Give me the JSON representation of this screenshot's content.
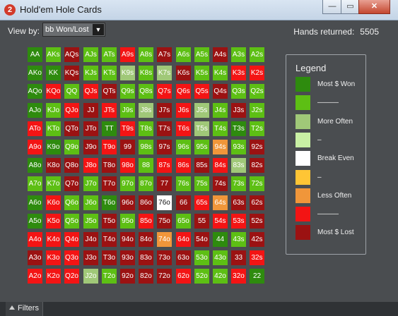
{
  "window": {
    "title": "Hold'em Hole Cards",
    "app_icon_text": "2",
    "minimize_glyph": "—",
    "maximize_glyph": "▭",
    "close_glyph": "✕"
  },
  "toolbar": {
    "view_by_label": "View by:",
    "view_by_value": "bb Won/Lost",
    "dropdown_arrow": "▼",
    "hands_label": "Hands returned:",
    "hands_value": "5505"
  },
  "colors": {
    "dg": "#2e8b0e",
    "mg": "#5dbf14",
    "lg": "#a0c878",
    "pg": "#c9f0a4",
    "wh": "#ffffff",
    "yl": "#ffc535",
    "or": "#f0963a",
    "rd": "#f31414",
    "dr": "#9b1212"
  },
  "grid": {
    "rows": [
      [
        {
          "t": "AA",
          "c": "dg"
        },
        {
          "t": "AKs",
          "c": "mg"
        },
        {
          "t": "AQs",
          "c": "dr"
        },
        {
          "t": "AJs",
          "c": "mg"
        },
        {
          "t": "ATs",
          "c": "mg"
        },
        {
          "t": "A9s",
          "c": "rd"
        },
        {
          "t": "A8s",
          "c": "mg"
        },
        {
          "t": "A7s",
          "c": "dr"
        },
        {
          "t": "A6s",
          "c": "mg"
        },
        {
          "t": "A5s",
          "c": "mg"
        },
        {
          "t": "A4s",
          "c": "dr"
        },
        {
          "t": "A3s",
          "c": "mg"
        },
        {
          "t": "A2s",
          "c": "mg"
        }
      ],
      [
        {
          "t": "AKo",
          "c": "dg"
        },
        {
          "t": "KK",
          "c": "dg"
        },
        {
          "t": "KQs",
          "c": "dr"
        },
        {
          "t": "KJs",
          "c": "mg"
        },
        {
          "t": "KTs",
          "c": "mg"
        },
        {
          "t": "K9s",
          "c": "lg"
        },
        {
          "t": "K8s",
          "c": "mg"
        },
        {
          "t": "K7s",
          "c": "lg"
        },
        {
          "t": "K6s",
          "c": "dr"
        },
        {
          "t": "K5s",
          "c": "mg"
        },
        {
          "t": "K4s",
          "c": "mg"
        },
        {
          "t": "K3s",
          "c": "rd"
        },
        {
          "t": "K2s",
          "c": "rd"
        }
      ],
      [
        {
          "t": "AQo",
          "c": "dg"
        },
        {
          "t": "KQo",
          "c": "rd"
        },
        {
          "t": "QQ",
          "c": "mg"
        },
        {
          "t": "QJs",
          "c": "rd"
        },
        {
          "t": "QTs",
          "c": "dr"
        },
        {
          "t": "Q9s",
          "c": "mg"
        },
        {
          "t": "Q8s",
          "c": "mg"
        },
        {
          "t": "Q7s",
          "c": "rd"
        },
        {
          "t": "Q6s",
          "c": "rd"
        },
        {
          "t": "Q5s",
          "c": "rd"
        },
        {
          "t": "Q4s",
          "c": "dr"
        },
        {
          "t": "Q3s",
          "c": "mg"
        },
        {
          "t": "Q2s",
          "c": "mg"
        }
      ],
      [
        {
          "t": "AJo",
          "c": "dg"
        },
        {
          "t": "KJo",
          "c": "mg"
        },
        {
          "t": "QJo",
          "c": "rd"
        },
        {
          "t": "JJ",
          "c": "dr"
        },
        {
          "t": "JTs",
          "c": "rd"
        },
        {
          "t": "J9s",
          "c": "mg"
        },
        {
          "t": "J8s",
          "c": "lg"
        },
        {
          "t": "J7s",
          "c": "dr"
        },
        {
          "t": "J6s",
          "c": "rd"
        },
        {
          "t": "J5s",
          "c": "lg"
        },
        {
          "t": "J4s",
          "c": "mg"
        },
        {
          "t": "J3s",
          "c": "dr"
        },
        {
          "t": "J2s",
          "c": "mg"
        }
      ],
      [
        {
          "t": "ATo",
          "c": "rd"
        },
        {
          "t": "KTo",
          "c": "mg"
        },
        {
          "t": "QTo",
          "c": "dr"
        },
        {
          "t": "JTo",
          "c": "dr"
        },
        {
          "t": "TT",
          "c": "dg"
        },
        {
          "t": "T9s",
          "c": "rd"
        },
        {
          "t": "T8s",
          "c": "mg"
        },
        {
          "t": "T7s",
          "c": "dr"
        },
        {
          "t": "T6s",
          "c": "rd"
        },
        {
          "t": "T5s",
          "c": "lg"
        },
        {
          "t": "T4s",
          "c": "mg"
        },
        {
          "t": "T3s",
          "c": "dg"
        },
        {
          "t": "T2s",
          "c": "mg"
        }
      ],
      [
        {
          "t": "A9o",
          "c": "rd"
        },
        {
          "t": "K9o",
          "c": "dg"
        },
        {
          "t": "Q9o",
          "c": "mg"
        },
        {
          "t": "J9o",
          "c": "dr"
        },
        {
          "t": "T9o",
          "c": "rd"
        },
        {
          "t": "99",
          "c": "dr"
        },
        {
          "t": "98s",
          "c": "mg"
        },
        {
          "t": "97s",
          "c": "dr"
        },
        {
          "t": "96s",
          "c": "mg"
        },
        {
          "t": "95s",
          "c": "mg"
        },
        {
          "t": "94s",
          "c": "or"
        },
        {
          "t": "93s",
          "c": "mg"
        },
        {
          "t": "92s",
          "c": "dr"
        }
      ],
      [
        {
          "t": "A8o",
          "c": "dg"
        },
        {
          "t": "K8o",
          "c": "dr"
        },
        {
          "t": "Q8o",
          "c": "dr"
        },
        {
          "t": "J8o",
          "c": "rd"
        },
        {
          "t": "T8o",
          "c": "dr"
        },
        {
          "t": "98o",
          "c": "rd"
        },
        {
          "t": "88",
          "c": "mg"
        },
        {
          "t": "87s",
          "c": "rd"
        },
        {
          "t": "86s",
          "c": "rd"
        },
        {
          "t": "85s",
          "c": "dr"
        },
        {
          "t": "84s",
          "c": "rd"
        },
        {
          "t": "83s",
          "c": "lg"
        },
        {
          "t": "82s",
          "c": "dr"
        }
      ],
      [
        {
          "t": "A7o",
          "c": "mg"
        },
        {
          "t": "K7o",
          "c": "mg"
        },
        {
          "t": "Q7o",
          "c": "dr"
        },
        {
          "t": "J7o",
          "c": "mg"
        },
        {
          "t": "T7o",
          "c": "dr"
        },
        {
          "t": "97o",
          "c": "mg"
        },
        {
          "t": "87o",
          "c": "mg"
        },
        {
          "t": "77",
          "c": "dr"
        },
        {
          "t": "76s",
          "c": "mg"
        },
        {
          "t": "75s",
          "c": "mg"
        },
        {
          "t": "74s",
          "c": "dr"
        },
        {
          "t": "73s",
          "c": "mg"
        },
        {
          "t": "72s",
          "c": "mg"
        }
      ],
      [
        {
          "t": "A6o",
          "c": "dg"
        },
        {
          "t": "K6o",
          "c": "rd"
        },
        {
          "t": "Q6o",
          "c": "mg"
        },
        {
          "t": "J6o",
          "c": "mg"
        },
        {
          "t": "T6o",
          "c": "dg"
        },
        {
          "t": "96o",
          "c": "dr"
        },
        {
          "t": "86o",
          "c": "dr"
        },
        {
          "t": "76o",
          "c": "wh"
        },
        {
          "t": "66",
          "c": "dr"
        },
        {
          "t": "65s",
          "c": "rd"
        },
        {
          "t": "64s",
          "c": "or"
        },
        {
          "t": "63s",
          "c": "dr"
        },
        {
          "t": "62s",
          "c": "dr"
        }
      ],
      [
        {
          "t": "A5o",
          "c": "dg"
        },
        {
          "t": "K5o",
          "c": "rd"
        },
        {
          "t": "Q5o",
          "c": "mg"
        },
        {
          "t": "J5o",
          "c": "mg"
        },
        {
          "t": "T5o",
          "c": "dr"
        },
        {
          "t": "95o",
          "c": "mg"
        },
        {
          "t": "85o",
          "c": "rd"
        },
        {
          "t": "75o",
          "c": "dr"
        },
        {
          "t": "65o",
          "c": "mg"
        },
        {
          "t": "55",
          "c": "dr"
        },
        {
          "t": "54s",
          "c": "rd"
        },
        {
          "t": "53s",
          "c": "rd"
        },
        {
          "t": "52s",
          "c": "dr"
        }
      ],
      [
        {
          "t": "A4o",
          "c": "rd"
        },
        {
          "t": "K4o",
          "c": "rd"
        },
        {
          "t": "Q4o",
          "c": "rd"
        },
        {
          "t": "J4o",
          "c": "dr"
        },
        {
          "t": "T4o",
          "c": "dr"
        },
        {
          "t": "94o",
          "c": "dr"
        },
        {
          "t": "84o",
          "c": "dr"
        },
        {
          "t": "74o",
          "c": "or"
        },
        {
          "t": "64o",
          "c": "rd"
        },
        {
          "t": "54o",
          "c": "dr"
        },
        {
          "t": "44",
          "c": "dg"
        },
        {
          "t": "43s",
          "c": "mg"
        },
        {
          "t": "42s",
          "c": "dr"
        }
      ],
      [
        {
          "t": "A3o",
          "c": "dr"
        },
        {
          "t": "K3o",
          "c": "rd"
        },
        {
          "t": "Q3o",
          "c": "rd"
        },
        {
          "t": "J3o",
          "c": "dr"
        },
        {
          "t": "T3o",
          "c": "dr"
        },
        {
          "t": "93o",
          "c": "dr"
        },
        {
          "t": "83o",
          "c": "dr"
        },
        {
          "t": "73o",
          "c": "dr"
        },
        {
          "t": "63o",
          "c": "dr"
        },
        {
          "t": "53o",
          "c": "mg"
        },
        {
          "t": "43o",
          "c": "mg"
        },
        {
          "t": "33",
          "c": "dr"
        },
        {
          "t": "32s",
          "c": "rd"
        }
      ],
      [
        {
          "t": "A2o",
          "c": "rd"
        },
        {
          "t": "K2o",
          "c": "rd"
        },
        {
          "t": "Q2o",
          "c": "rd"
        },
        {
          "t": "J2o",
          "c": "lg"
        },
        {
          "t": "T2o",
          "c": "mg"
        },
        {
          "t": "92o",
          "c": "dr"
        },
        {
          "t": "82o",
          "c": "dr"
        },
        {
          "t": "72o",
          "c": "dr"
        },
        {
          "t": "62o",
          "c": "rd"
        },
        {
          "t": "52o",
          "c": "mg"
        },
        {
          "t": "42o",
          "c": "mg"
        },
        {
          "t": "32o",
          "c": "rd"
        },
        {
          "t": "22",
          "c": "dg"
        }
      ]
    ]
  },
  "legend": {
    "title": "Legend",
    "items": [
      {
        "label": "Most $ Won",
        "c": "dg"
      },
      {
        "label": "———",
        "c": "mg"
      },
      {
        "label": "More Often",
        "c": "lg"
      },
      {
        "label": "–",
        "c": "pg"
      },
      {
        "label": "Break Even",
        "c": "wh"
      },
      {
        "label": "–",
        "c": "yl"
      },
      {
        "label": "Less Often",
        "c": "or"
      },
      {
        "label": "———",
        "c": "rd"
      },
      {
        "label": "Most $ Lost",
        "c": "dr"
      }
    ]
  },
  "footer": {
    "filters_label": "Filters"
  }
}
